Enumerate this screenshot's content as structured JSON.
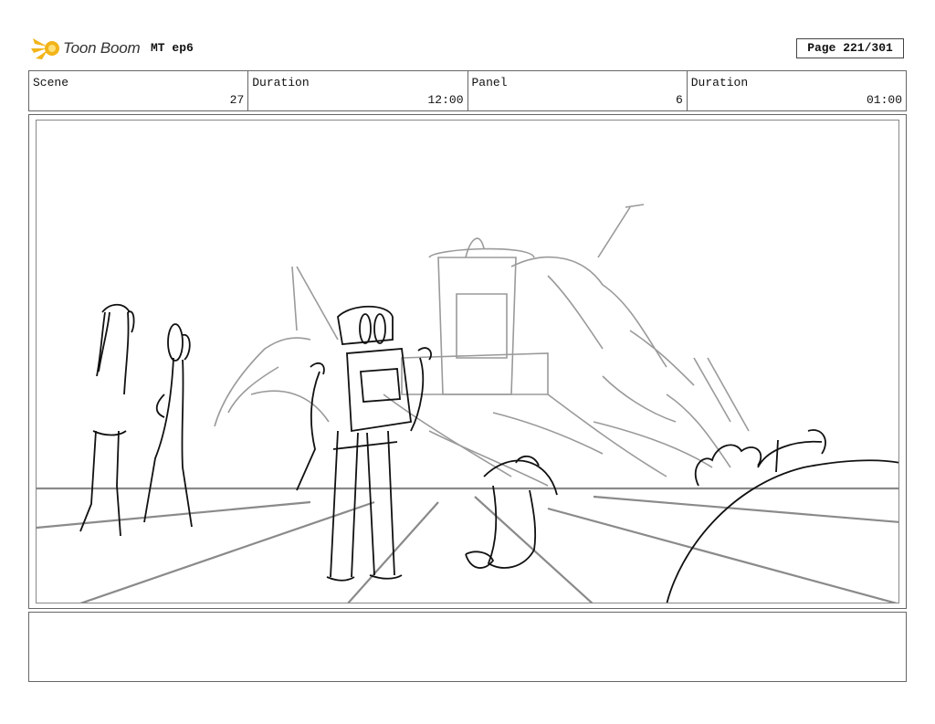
{
  "header": {
    "brand": "Toon Boom",
    "project": "MT ep6",
    "page_label": "Page 221/301"
  },
  "info": {
    "scene_label": "Scene",
    "scene_value": "27",
    "scene_duration_label": "Duration",
    "scene_duration_value": "12:00",
    "panel_label": "Panel",
    "panel_value": "6",
    "panel_duration_label": "Duration",
    "panel_duration_value": "01:00"
  },
  "colors": {
    "logo_accent": "#f2b418",
    "robot_eyes": "#c05a66"
  },
  "notes": {
    "text": ""
  }
}
